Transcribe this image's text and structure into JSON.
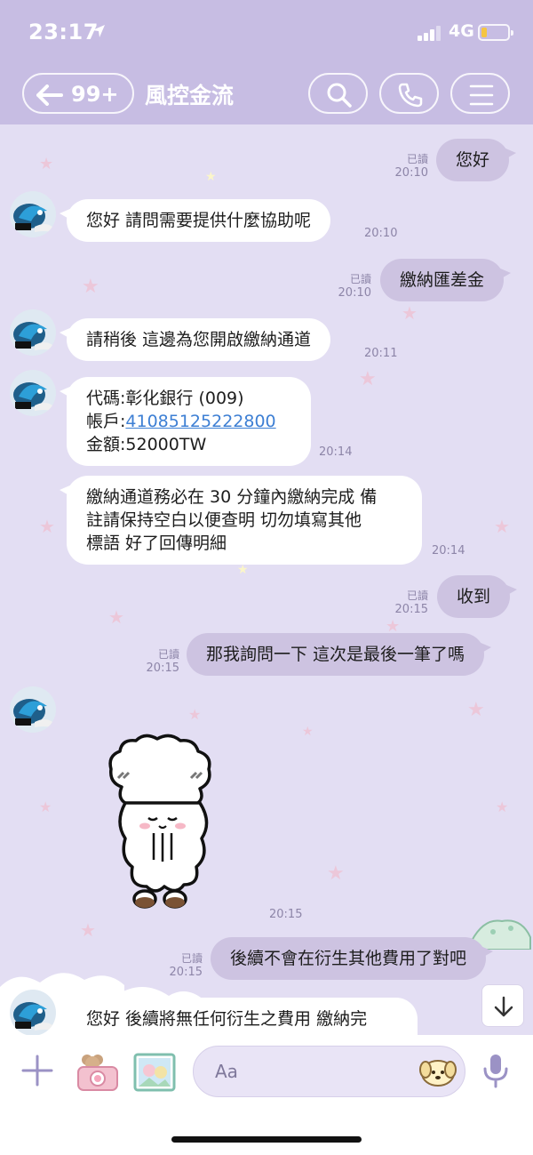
{
  "status_bar": {
    "time": "23:17",
    "network": "4G"
  },
  "nav": {
    "back_count": "99+",
    "title": "風控金流"
  },
  "messages": [
    {
      "text": "您好",
      "read": "已讀",
      "time": "20:10"
    },
    {
      "text": "您好 請問需要提供什麼協助呢",
      "time": "20:10"
    },
    {
      "text": "繳納匯差金",
      "read": "已讀",
      "time": "20:10"
    },
    {
      "text": "請稍後 這邊為您開啟繳納通道",
      "time": "20:11"
    },
    {
      "line1": "代碼:彰化銀行 (009)",
      "line2_label": "帳戶:",
      "line2_link": "41085125222800",
      "line3": "金額:52000TW",
      "time": "20:14"
    },
    {
      "line1": "繳納通道務必在 30 分鐘內繳納完成 備",
      "line2": "註請保持空白以便查明 切勿填寫其他",
      "line3": "標語 好了回傳明細",
      "time": "20:14"
    },
    {
      "text": "收到",
      "read": "已讀",
      "time": "20:15"
    },
    {
      "text": "那我詢問一下 這次是最後一筆了嗎",
      "read": "已讀",
      "time": "20:15"
    },
    {
      "sticker": "bowing-sheep-sticker",
      "time": "20:15"
    },
    {
      "text": "後續不會在衍生其他費用了對吧",
      "read": "已讀",
      "time": "20:15"
    },
    {
      "text": "您好 後續將無任何衍生之費用 繳納完"
    }
  ],
  "input": {
    "placeholder": "Aa"
  },
  "colors": {
    "header": "#c7bde3",
    "chat_bg": "#e3def3",
    "out_bubble": "#cdc3e1",
    "link": "#3d7fd4"
  }
}
